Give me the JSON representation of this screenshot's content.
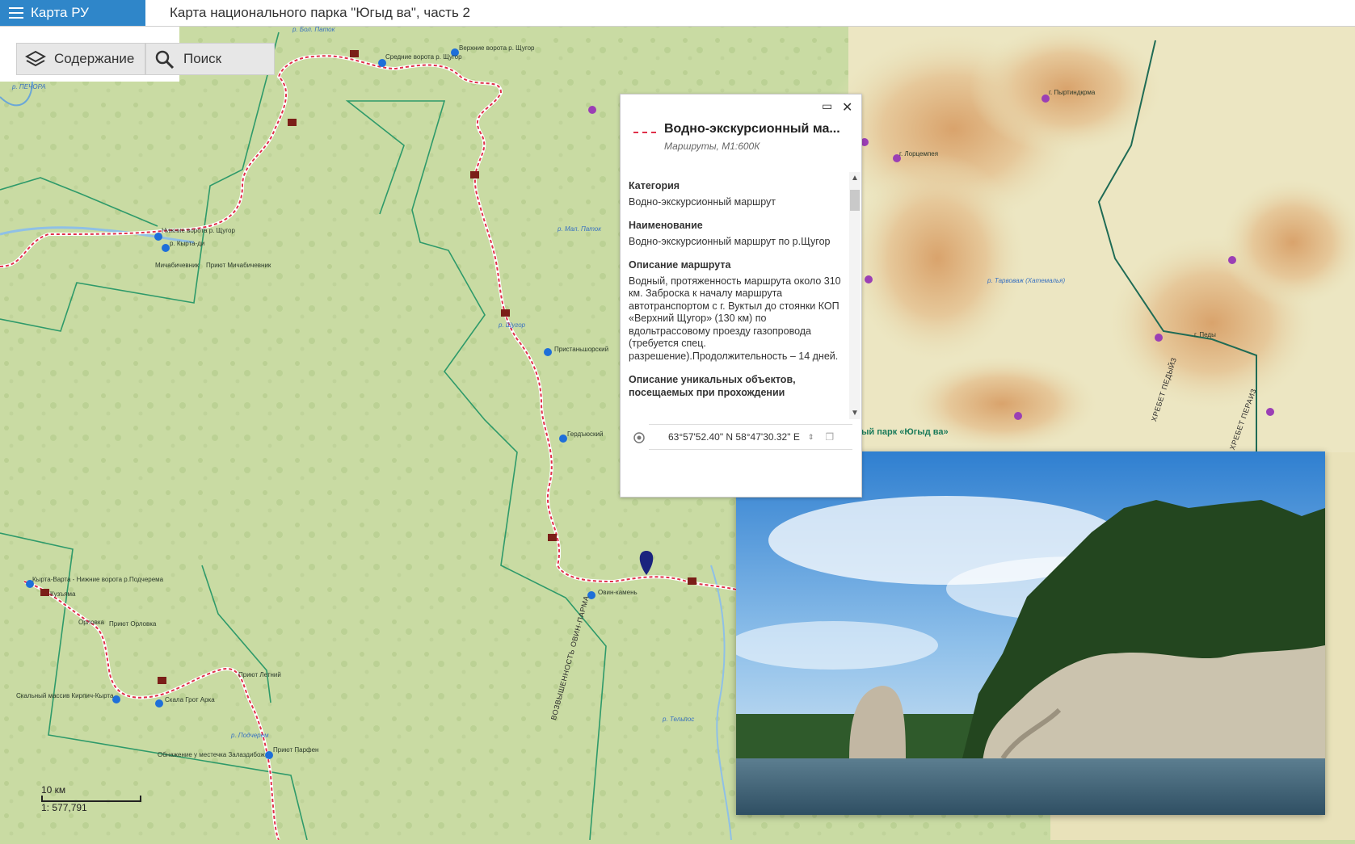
{
  "app": {
    "brand": "Карта РУ",
    "title": "Карта национального парка \"Югыд ва\", часть 2"
  },
  "toolbar": {
    "contents_label": "Содержание",
    "search_label": "Поиск",
    "contents_icon": "layers-icon",
    "search_icon": "search-icon"
  },
  "popup": {
    "title": "Водно-экскурсионный ма...",
    "subtitle": "Маршруты, М1:600К",
    "fields": [
      {
        "label": "Категория",
        "value": "Водно-экскурсионный маршрут"
      },
      {
        "label": "Наименование",
        "value": "Водно-экскурсионный маршрут по р.Щугор"
      },
      {
        "label": "Описание маршрута",
        "value": "Водный, протяженность маршрута около 310 км. Заброска к началу маршрута автотранспортом с г. Вуктыл до стоянки КОП «Верхний Щугор» (130 км) по вдольтрассовому проезду газопровода (требуется спец. разрешение).Продолжительность – 14 дней."
      },
      {
        "label": "Описание уникальных объектов, посещаемых при прохождении",
        "value": ""
      }
    ],
    "coordinates": "63°57'52.40\" N 58°47'30.32\" E",
    "maximize_icon": "maximize-icon",
    "close_icon": "close-icon",
    "locate_icon": "locate-icon",
    "copy_icon": "copy-icon"
  },
  "scale": {
    "distance": "10 км",
    "ratio": "1: 577,791"
  },
  "map_labels": {
    "river_bol_patok": "р. Бол. Паток",
    "srednie_vorota": "Средние ворота р. Щугор",
    "verkhnie_vorota": "Верхние ворота р. Щугор",
    "pechora": "р. ПЕЧОРА",
    "nizhnie_vorota": "Нижние ворота р. Щугор",
    "kyrta_dzh": "р. Кырта-ди",
    "michabichevnik": "Мичабичевник",
    "priyut_michabichevnik": "Приют Мичабичевник",
    "mal_patok": "р. Мал. Паток",
    "shchugor": "р. Щугор",
    "pristanshorsky": "Пристаньшорский",
    "gerdyusky": "Гердъюский",
    "ovin_kamen": "Овин-камень",
    "kyrta_varta": "Кырта-Варта - Нижние ворота р.Подчерема",
    "kuzyama": "Кузъяма",
    "orlovka": "Орловка",
    "priyut_orlovka": "Приют Орловка",
    "priyut_letny": "Приют Летний",
    "skalny_massiv": "Скальный массив Кирпич-Кырта",
    "skala_grot": "Скала Грот Арка",
    "podcherem": "р. Подчерем",
    "obnazhenie": "Обнажение у местечка Залаздибож",
    "priyut_parfen": "Приют Парфен",
    "vozvyshennost": "ВОЗВЫШЕННОСТЬ ОВИН-ПАРМА",
    "telpos": "р. Тельпос",
    "pyrtindkrma": "г. Пыртиндкрма",
    "lortsempya": "г. Лорцемпея",
    "tarvag": "р. Тарвоваж (Хатемалья)",
    "pedy": "г. Педы",
    "khrebet_pedyiz": "ХРЕБЕТ ПЕДЫЙЗ",
    "khrebet_peraiz": "ХРЕБЕТ ПЕРАИЗ",
    "park_label": "ый парк «Югыд ва»"
  }
}
